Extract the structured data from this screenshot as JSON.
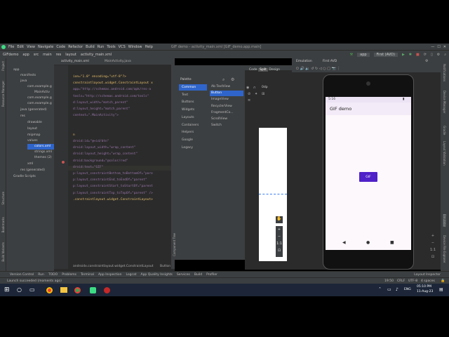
{
  "menu": [
    "File",
    "Edit",
    "View",
    "Navigate",
    "Code",
    "Refactor",
    "Build",
    "Run",
    "Tools",
    "VCS",
    "Window",
    "Help"
  ],
  "window_title": "GIF demo - activity_main.xml [GIF_demo.app.main]",
  "breadcrumb": [
    "GIFdemo",
    "app",
    "src",
    "main",
    "res",
    "layout",
    "activity_main.xml"
  ],
  "run_config": "app",
  "device_select": "First (AVD)",
  "editor_tabs": [
    "activity_main.xml",
    "MainActivity.java"
  ],
  "tree": [
    "app",
    "manifests",
    "java",
    "com.example.g",
    "MainActiv",
    "com.example.g",
    "com.example.g",
    "java (generated)",
    "res",
    "drawable",
    "layout",
    "mipmap",
    "values",
    "colors.xml",
    "strings.xml",
    "themes (2)",
    "xml",
    "res (generated)",
    "Gradle Scripts"
  ],
  "code_lines": [
    "ion=\"1.0\" encoding=\"utf-8\"?>",
    "constraintlayout.widget.ConstraintLayout x",
    "app=\"http://schemas.android.com/apk/res-a",
    "tools=\"http://schemas.android.com/tools\"",
    "d:layout_width=\"match_parent\"",
    "d:layout_height=\"match_parent\"",
    "context=\".MainActivity\">",
    "",
    "",
    "n",
    "droid:id=\"@+id/btn\"",
    "droid:layout_width=\"wrap_content\"",
    "droid:layout_height=\"wrap_content\"",
    "droid:background=\"@color/red\"",
    "droid:text=\"GIF\"",
    "p:layout_constraintBottom_toBottomOf=\"pare",
    "p:layout_constraintEnd_toEndOf=\"parent\"",
    "p:layout_constraintStart_toStartOf=\"parent",
    "p:layout_constraintTop_toTopOf=\"parent\" />",
    ".constraintlayout.widget.ConstraintLayout>"
  ],
  "palette_header": "Palette",
  "palette_categories": [
    "Common",
    "Text",
    "Buttons",
    "Widgets",
    "Layouts",
    "Containers",
    "Helpers",
    "Google",
    "Legacy"
  ],
  "palette_items": [
    "Ab TextView",
    "Button",
    "ImageView",
    "RecyclerView",
    "FragmentCo...",
    "ScrollView",
    "Switch"
  ],
  "design_modes": [
    "Code",
    "Split",
    "Design"
  ],
  "zoom_label": "0dp",
  "design_label": "1:1",
  "emulation_tab": "Emulation",
  "emulator_tab": "First AVD",
  "phone_status_time": "5:16",
  "app_title": "GIF demo",
  "button_text": "GIF",
  "editor_breadcrumb": [
    "androidx.constraintlayout.widget.ConstraintLayout",
    "Button"
  ],
  "component_tree_label": "Component Tree",
  "bottom_tabs": [
    "Version Control",
    "Run",
    "TODO",
    "Problems",
    "Terminal",
    "App Inspection",
    "Logcat",
    "App Quality Insights",
    "Services",
    "Build",
    "Profiler"
  ],
  "layout_inspector": "Layout Inspector",
  "status_left": "Launch succeeded (moments ago)",
  "status_right": [
    "19:50",
    "CRLF",
    "UTF-8",
    "4 spaces"
  ],
  "taskbar_time": "05:10 PM",
  "taskbar_date": "11-Aug-23",
  "taskbar_lang": "ENG",
  "left_tools": [
    "Project",
    "Resource Manager",
    "Structure",
    "Bookmarks",
    "Build Variants"
  ],
  "right_tools": [
    "Notifications",
    "Device Manager",
    "Gradle",
    "Layout Validation",
    "Emulator",
    "Device File Explorer"
  ],
  "colors": {
    "accent": "#4f21c8",
    "ide": "#3c3f41",
    "editor": "#2b2b2b",
    "selected": "#2f65ca"
  }
}
